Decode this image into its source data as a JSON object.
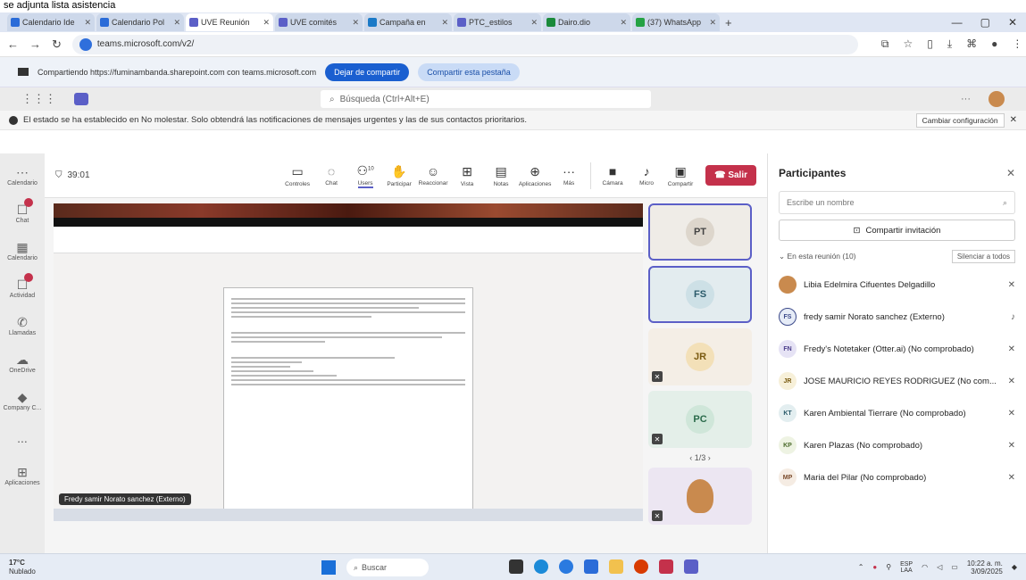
{
  "caption": "se adjunta lista asistencia",
  "tabs": [
    {
      "label": "Calendario Ide",
      "color": "#2b6cd8"
    },
    {
      "label": "Calendario Pol",
      "color": "#2b6cd8"
    },
    {
      "label": "UVE Reunión",
      "color": "#5b5fc7"
    },
    {
      "label": "UVE comités",
      "color": "#5b5fc7"
    },
    {
      "label": "Campaña en",
      "color": "#1b7ac7"
    },
    {
      "label": "PTC_estilos",
      "color": "#5b5fc7"
    },
    {
      "label": "Dairo.dio",
      "color": "#1a8a3a"
    },
    {
      "label": "(37) WhatsApp",
      "color": "#25a244"
    }
  ],
  "address": {
    "url": "teams.microsoft.com/v2/"
  },
  "sharebar": {
    "text": "Compartiendo https://fuminambanda.sharepoint.com con teams.microsoft.com",
    "stop_label": "Dejar de compartir",
    "share_tab_label": "Compartir esta pestaña"
  },
  "teams": {
    "search_placeholder": "Búsqueda (Ctrl+Alt+E)"
  },
  "notice": {
    "text": "El estado se ha establecido en No molestar. Solo obtendrá las notificaciones de mensajes urgentes y las de sus contactos prioritarios.",
    "button": "Cambiar configuración"
  },
  "rail": [
    {
      "label": "Calendario",
      "icon": "calendar-icon",
      "badge": false
    },
    {
      "label": "Chat",
      "icon": "chat-icon",
      "badge": true
    },
    {
      "label": "Calendario",
      "icon": "calendar-grid-icon",
      "badge": false
    },
    {
      "label": "Actividad",
      "icon": "bell-icon",
      "badge": true
    },
    {
      "label": "Llamadas",
      "icon": "phone-icon",
      "badge": false
    },
    {
      "label": "OneDrive",
      "icon": "cloud-icon",
      "badge": false
    },
    {
      "label": "Company C...",
      "icon": "building-icon",
      "badge": false
    },
    {
      "label": "...",
      "icon": "more-icon",
      "badge": false
    },
    {
      "label": "Aplicaciones",
      "icon": "apps-icon",
      "badge": false
    }
  ],
  "meeting": {
    "timer": "39:01",
    "controls": [
      {
        "label": "Controles",
        "icon": "panel-icon"
      },
      {
        "label": "Chat",
        "icon": "chat-icon"
      },
      {
        "label": "Users",
        "icon": "people-icon",
        "count": "10"
      },
      {
        "label": "Participar",
        "icon": "hand-icon"
      },
      {
        "label": "Reaccionar",
        "icon": "smile-icon"
      },
      {
        "label": "Vista",
        "icon": "grid-icon"
      },
      {
        "label": "Notas",
        "icon": "notes-icon"
      },
      {
        "label": "Aplicaciones",
        "icon": "plus-icon"
      },
      {
        "label": "Más",
        "icon": "more-icon"
      }
    ],
    "camera_label": "Cámara",
    "mic_label": "Micro",
    "share_label": "Compartir",
    "leave_label": "Salir",
    "presenter_chip": "Fredy samir Norato sanchez (Externo)"
  },
  "tiles": [
    {
      "initials": "PT",
      "bg": "#efece7",
      "selected": true,
      "muted": false
    },
    {
      "initials": "FS",
      "bg": "#e3ecef",
      "selected": true,
      "muted": false
    },
    {
      "initials": "JR",
      "bg": "#f4eee6",
      "selected": false,
      "muted": true
    },
    {
      "initials": "PC",
      "bg": "#e4efe9",
      "selected": false,
      "muted": true
    }
  ],
  "pager": "1/3",
  "panel": {
    "title": "Participantes",
    "search_placeholder": "Escribe un nombre",
    "invite_label": "Compartir invitación",
    "section_label": "En esta reunión (10)",
    "mute_all_label": "Silenciar a todos",
    "people": [
      {
        "name": "Libia Edelmira Cifuentes Delgadillo",
        "initials": "",
        "bg": "#c98a4e",
        "fg": "#fff"
      },
      {
        "name": "fredy samir Norato sanchez (Externo)",
        "initials": "FS",
        "bg": "#e6ecf7",
        "fg": "#3c4a8a"
      },
      {
        "name": "Fredy's Notetaker (Otter.ai) (No comprobado)",
        "initials": "FN",
        "bg": "#e6e3f5",
        "fg": "#4a3c8a"
      },
      {
        "name": "JOSE MAURICIO REYES RODRIGUEZ (No com...",
        "initials": "JR",
        "bg": "#f7f0d9",
        "fg": "#7a5a10"
      },
      {
        "name": "Karen Ambiental Tierrare (No comprobado)",
        "initials": "KT",
        "bg": "#e3eef0",
        "fg": "#2a5a6a"
      },
      {
        "name": "Karen Plazas (No comprobado)",
        "initials": "KP",
        "bg": "#eef3e3",
        "fg": "#4a6a2a"
      },
      {
        "name": "Maria del Pilar (No comprobado)",
        "initials": "MP",
        "bg": "#f5ece3",
        "fg": "#7a4a2a"
      }
    ]
  },
  "taskbar": {
    "weather_temp": "17°C",
    "weather_desc": "Nublado",
    "search": "Buscar",
    "lang": "ESP",
    "lang2": "LAA",
    "time": "10:22 a. m.",
    "date": "3/09/2025"
  }
}
